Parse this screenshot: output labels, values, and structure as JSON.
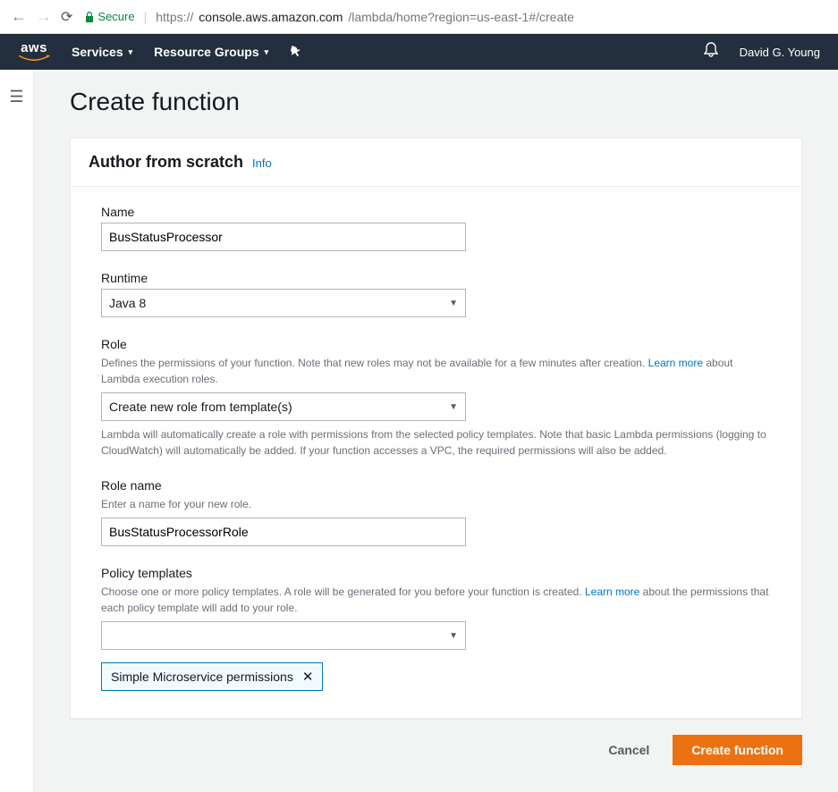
{
  "browser": {
    "secure_label": "Secure",
    "url_scheme": "https://",
    "url_host": "console.aws.amazon.com",
    "url_path": "/lambda/home?region=us-east-1#/create"
  },
  "nav": {
    "logo": "aws",
    "services": "Services",
    "resource_groups": "Resource Groups",
    "user": "David G. Young"
  },
  "page": {
    "title": "Create function"
  },
  "panel": {
    "header": "Author from scratch",
    "info": "Info"
  },
  "form": {
    "name": {
      "label": "Name",
      "value": "BusStatusProcessor"
    },
    "runtime": {
      "label": "Runtime",
      "value": "Java 8"
    },
    "role": {
      "label": "Role",
      "desc_pre": "Defines the permissions of your function. Note that new roles may not be available for a few minutes after creation. ",
      "learn_more": "Learn more",
      "desc_post": " about Lambda execution roles.",
      "value": "Create new role from template(s)",
      "after": "Lambda will automatically create a role with permissions from the selected policy templates. Note that basic Lambda permissions (logging to CloudWatch) will automatically be added. If your function accesses a VPC, the required permissions will also be added."
    },
    "role_name": {
      "label": "Role name",
      "desc": "Enter a name for your new role.",
      "value": "BusStatusProcessorRole"
    },
    "policy": {
      "label": "Policy templates",
      "desc_pre": "Choose one or more policy templates. A role will be generated for you before your function is created. ",
      "learn_more": "Learn more",
      "desc_post": " about the permissions that each policy template will add to your role.",
      "value": "",
      "chip": "Simple Microservice permissions"
    }
  },
  "footer": {
    "cancel": "Cancel",
    "create": "Create function"
  }
}
